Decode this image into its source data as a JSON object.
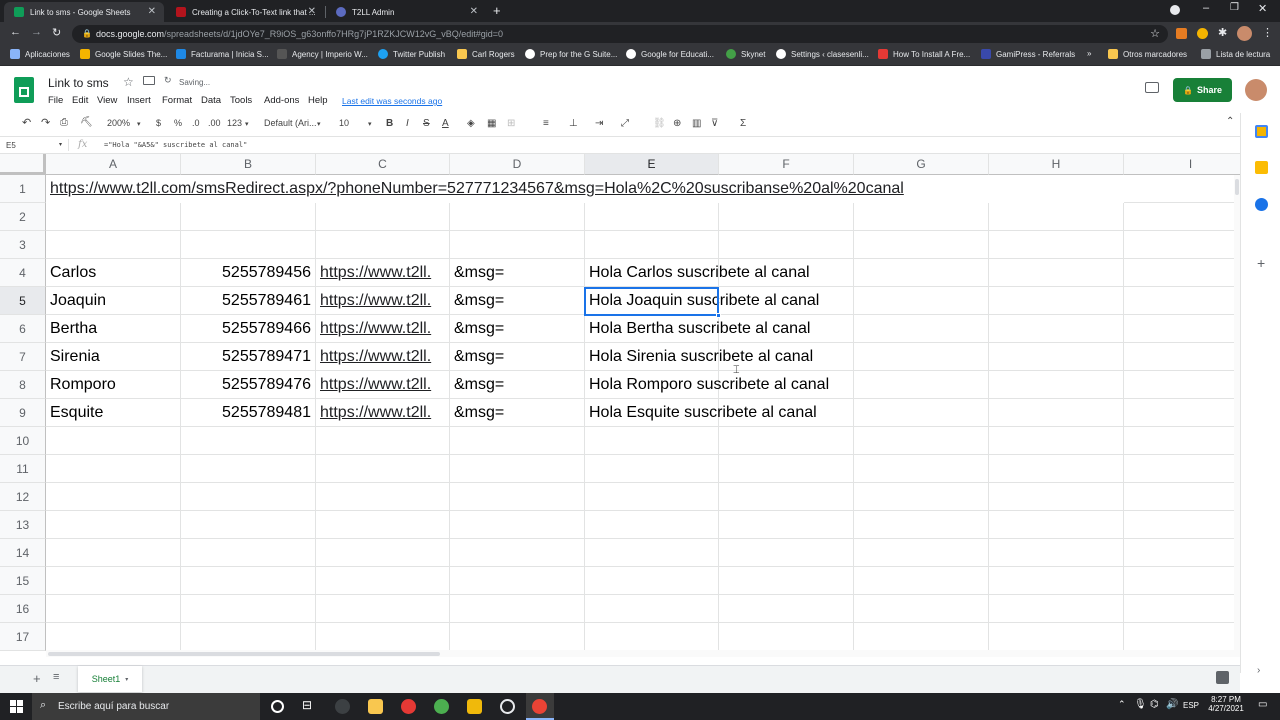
{
  "browser": {
    "tabs": [
      {
        "title": "Link to sms - Google Sheets",
        "color": "#0f9d58"
      },
      {
        "title": "Creating a Click-To-Text link that ...",
        "color": "#b3141d"
      },
      {
        "title": "T2LL Admin",
        "color": "#5c6bc0"
      }
    ],
    "new_tab": "+",
    "url_domain": "docs.google.com",
    "url_path": "/spreadsheets/d/1jdOYe7_R9iOS_g63onffo7HRg7jP1RZKJCW12vG_vBQ/edit#gid=0",
    "bookmarks": [
      {
        "label": "Aplicaciones",
        "color": "#8ab4f8"
      },
      {
        "label": "Google Slides The...",
        "color": "#f4b400"
      },
      {
        "label": "Facturama | Inicia S...",
        "color": "#1e88e5"
      },
      {
        "label": "Agency | Imperio W...",
        "color": "#555555"
      },
      {
        "label": "Twitter Publish",
        "color": "#1da1f2"
      },
      {
        "label": "Carl Rogers",
        "color": "#f9c74f"
      },
      {
        "label": "Prep for the G Suite...",
        "color": "#ffffff"
      },
      {
        "label": "Google for Educati...",
        "color": "#ffffff"
      },
      {
        "label": "Skynet",
        "color": "#43a047"
      },
      {
        "label": "Settings ‹ clasesenli...",
        "color": "#ffffff"
      },
      {
        "label": "How To Install A Fre...",
        "color": "#e53935"
      },
      {
        "label": "GamiPress - Referrals",
        "color": "#3949ab"
      },
      {
        "label": "»",
        "color": ""
      },
      {
        "label": "Otros marcadores",
        "color": "#f9c74f"
      },
      {
        "label": "Lista de lectura",
        "color": "#9aa0a6"
      }
    ]
  },
  "sheets": {
    "title": "Link to sms",
    "saving": "Saving...",
    "menu": [
      "File",
      "Edit",
      "View",
      "Insert",
      "Format",
      "Data",
      "Tools",
      "Add-ons",
      "Help"
    ],
    "last_edit": "Last edit was seconds ago",
    "share_label": "Share",
    "toolbar": {
      "zoom": "200%",
      "currency": "$",
      "percent": "%",
      "dec_less": ".0",
      "dec_more": ".00",
      "format": "123",
      "font": "Default (Ari...",
      "font_size": "10",
      "bold": "B",
      "italic": "I",
      "sigma": "Σ"
    },
    "name_box": "E5",
    "fx": "fx",
    "formula": "=\"Hola \"&A5&\" suscribete al canal\"",
    "columns": [
      "A",
      "B",
      "C",
      "D",
      "E",
      "F",
      "G",
      "H",
      "I"
    ],
    "rows": [
      "1",
      "2",
      "3",
      "4",
      "5",
      "6",
      "7",
      "8",
      "9",
      "10",
      "11",
      "12",
      "13",
      "14",
      "15",
      "16",
      "17"
    ],
    "row1_link": "https://www.t2ll.com/smsRedirect.aspx/?phoneNumber=527771234567&msg=Hola%2C%20suscribanse%20al%20canal",
    "data_rows": [
      {
        "name": "Carlos",
        "phone": "5255789456",
        "link": "https://www.t2ll.",
        "msg": "&msg=",
        "text": "Hola Carlos suscribete al canal"
      },
      {
        "name": "Joaquin",
        "phone": "5255789461",
        "link": "https://www.t2ll.",
        "msg": "&msg=",
        "text": "Hola Joaquin suscribete al canal"
      },
      {
        "name": "Bertha",
        "phone": "5255789466",
        "link": "https://www.t2ll.",
        "msg": "&msg=",
        "text": "Hola Bertha suscribete al canal"
      },
      {
        "name": "Sirenia",
        "phone": "5255789471",
        "link": "https://www.t2ll.",
        "msg": "&msg=",
        "text": "Hola Sirenia suscribete al canal"
      },
      {
        "name": "Romporo",
        "phone": "5255789476",
        "link": "https://www.t2ll.",
        "msg": "&msg=",
        "text": "Hola Romporo suscribete al canal"
      },
      {
        "name": "Esquite",
        "phone": "5255789481",
        "link": "https://www.t2ll.",
        "msg": "&msg=",
        "text": "Hola Esquite suscribete al canal"
      }
    ],
    "sheet_tab": "Sheet1",
    "accent": "#1a73e8",
    "share_color": "#188038"
  },
  "taskbar": {
    "search_placeholder": "Escribe aquí para buscar",
    "lang": "ESP",
    "time": "8:27 PM",
    "date": "4/27/2021"
  }
}
